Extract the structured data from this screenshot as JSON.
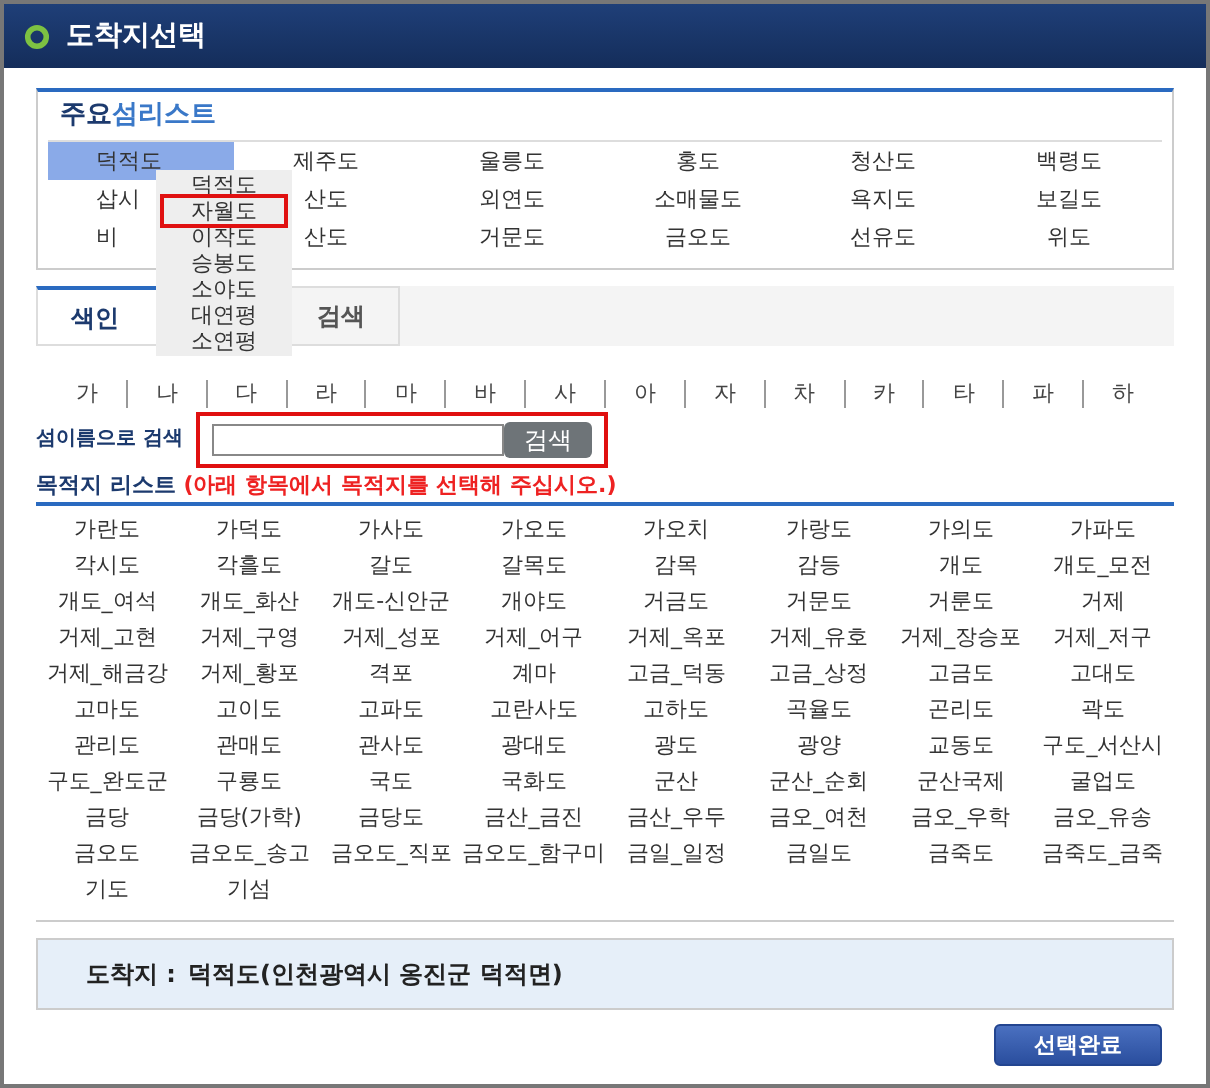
{
  "window": {
    "title": "도착지선택"
  },
  "main_list": {
    "title_main": "주요",
    "title_accent": "섬리스트",
    "items": [
      {
        "label": "덕적도",
        "selected": true
      },
      {
        "label": "제주도",
        "selected": false
      },
      {
        "label": "울릉도",
        "selected": false
      },
      {
        "label": "홍도",
        "selected": false
      },
      {
        "label": "청산도",
        "selected": false
      },
      {
        "label": "백령도",
        "selected": false
      },
      {
        "label": "삽시",
        "selected": false
      },
      {
        "label": "산도",
        "selected": false
      },
      {
        "label": "외연도",
        "selected": false
      },
      {
        "label": "소매물도",
        "selected": false
      },
      {
        "label": "욕지도",
        "selected": false
      },
      {
        "label": "보길도",
        "selected": false
      },
      {
        "label": "비",
        "selected": false
      },
      {
        "label": "산도",
        "selected": false
      },
      {
        "label": "거문도",
        "selected": false
      },
      {
        "label": "금오도",
        "selected": false
      },
      {
        "label": "선유도",
        "selected": false
      },
      {
        "label": "위도",
        "selected": false
      }
    ]
  },
  "dropdown": {
    "items": [
      {
        "label": "덕적도",
        "highlighted": false
      },
      {
        "label": "자월도",
        "highlighted": true
      },
      {
        "label": "이작도",
        "highlighted": false
      },
      {
        "label": "승봉도",
        "highlighted": false
      },
      {
        "label": "소야도",
        "highlighted": false
      },
      {
        "label": "대연평",
        "highlighted": false
      },
      {
        "label": "소연평",
        "highlighted": false
      }
    ]
  },
  "tabs": [
    {
      "label": "색인",
      "selected": true
    },
    {
      "label": "검색",
      "selected": false
    }
  ],
  "index_letters": [
    "가",
    "나",
    "다",
    "라",
    "마",
    "바",
    "사",
    "아",
    "자",
    "차",
    "카",
    "타",
    "파",
    "하"
  ],
  "search": {
    "label": "섬이름으로 검색",
    "button": "검색",
    "highlighted": true
  },
  "destination_list": {
    "title": "목적지 리스트",
    "note": "(아래 항목에서 목적지를 선택해 주십시오.)",
    "items": [
      "가란도",
      "가덕도",
      "가사도",
      "가오도",
      "가오치",
      "가랑도",
      "가의도",
      "가파도",
      "각시도",
      "각흘도",
      "갈도",
      "갈목도",
      "감목",
      "감등",
      "개도",
      "개도_모전",
      "개도_여석",
      "개도_화산",
      "개도-신안군",
      "개야도",
      "거금도",
      "거문도",
      "거룬도",
      "거제",
      "거제_고현",
      "거제_구영",
      "거제_성포",
      "거제_어구",
      "거제_옥포",
      "거제_유호",
      "거제_장승포",
      "거제_저구",
      "거제_해금강",
      "거제_황포",
      "격포",
      "계마",
      "고금_덕동",
      "고금_상정",
      "고금도",
      "고대도",
      "고마도",
      "고이도",
      "고파도",
      "고란사도",
      "고하도",
      "곡율도",
      "곤리도",
      "곽도",
      "관리도",
      "관매도",
      "관사도",
      "광대도",
      "광도",
      "광양",
      "교동도",
      "구도_서산시",
      "구도_완도군",
      "구룡도",
      "국도",
      "국화도",
      "군산",
      "군산_순회",
      "군산국제",
      "굴업도",
      "금당",
      "금당(가학)",
      "금당도",
      "금산_금진",
      "금산_우두",
      "금오_여천",
      "금오_우학",
      "금오_유송",
      "금오도",
      "금오도_송고",
      "금오도_직포",
      "금오도_함구미",
      "금일_일정",
      "금일도",
      "금죽도",
      "금죽도_금죽",
      "기도",
      "기섬"
    ]
  },
  "arrival": {
    "label": "도착지 :",
    "value": "덕적도(인천광역시 옹진군 덕적면)"
  },
  "buttons": [
    "선택완료"
  ]
}
